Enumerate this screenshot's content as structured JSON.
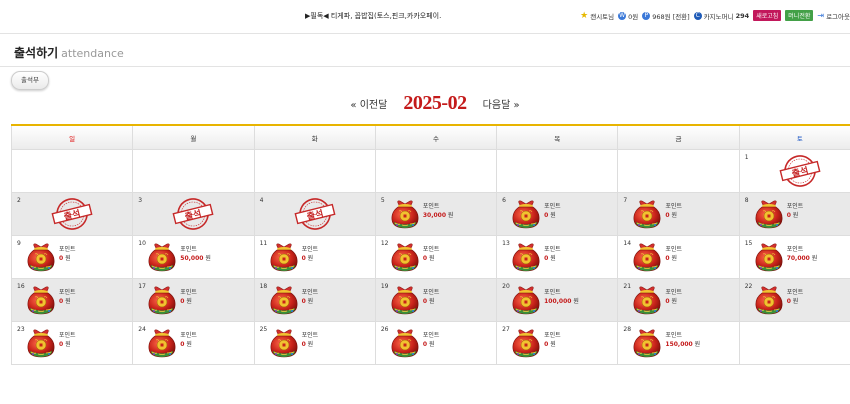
{
  "topbar": {
    "notice": "▶필독◀ 티게파, 꼽밥집(토스,핀크,카카오페이.",
    "user": {
      "name": "캔시토님",
      "w_value": "0원",
      "p_value": "968원",
      "p_suffix": "[전환]",
      "casino_label": "카지노머니",
      "casino_value": "294",
      "refresh_label": "새로고침",
      "withdraw_label": "머니전환",
      "logout_label": "로그아웃"
    }
  },
  "page": {
    "title": "출석하기",
    "subtitle": "attendance",
    "attendance_button": "출석부"
  },
  "nav": {
    "prev": "« 이전달",
    "month": "2025-02",
    "next": "다음달 »"
  },
  "calendar": {
    "weekdays": [
      "일",
      "월",
      "화",
      "수",
      "목",
      "금",
      "토"
    ],
    "point_label": "포인트",
    "stamp_text": "출석",
    "unit": "원",
    "weeks": [
      [
        {
          "day": ""
        },
        {
          "day": ""
        },
        {
          "day": ""
        },
        {
          "day": ""
        },
        {
          "day": ""
        },
        {
          "day": ""
        },
        {
          "day": "1",
          "stamp": true
        }
      ],
      [
        {
          "day": "2",
          "stamp": true
        },
        {
          "day": "3",
          "stamp": true
        },
        {
          "day": "4",
          "stamp": true
        },
        {
          "day": "5",
          "amount": "30,000"
        },
        {
          "day": "6",
          "amount": "0"
        },
        {
          "day": "7",
          "amount": "0"
        },
        {
          "day": "8",
          "amount": "0"
        }
      ],
      [
        {
          "day": "9",
          "amount": "0"
        },
        {
          "day": "10",
          "amount": "50,000"
        },
        {
          "day": "11",
          "amount": "0"
        },
        {
          "day": "12",
          "amount": "0"
        },
        {
          "day": "13",
          "amount": "0"
        },
        {
          "day": "14",
          "amount": "0"
        },
        {
          "day": "15",
          "amount": "70,000"
        }
      ],
      [
        {
          "day": "16",
          "amount": "0"
        },
        {
          "day": "17",
          "amount": "0"
        },
        {
          "day": "18",
          "amount": "0"
        },
        {
          "day": "19",
          "amount": "0"
        },
        {
          "day": "20",
          "amount": "100,000"
        },
        {
          "day": "21",
          "amount": "0"
        },
        {
          "day": "22",
          "amount": "0"
        }
      ],
      [
        {
          "day": "23",
          "amount": "0"
        },
        {
          "day": "24",
          "amount": "0"
        },
        {
          "day": "25",
          "amount": "0"
        },
        {
          "day": "26",
          "amount": "0"
        },
        {
          "day": "27",
          "amount": "0"
        },
        {
          "day": "28",
          "amount": "150,000"
        },
        {
          "day": ""
        }
      ]
    ],
    "shaded_rows": [
      1,
      3
    ]
  },
  "colors": {
    "accent_red": "#c41a1a",
    "header_border": "#e8b400",
    "stamp_red": "#c62828"
  }
}
